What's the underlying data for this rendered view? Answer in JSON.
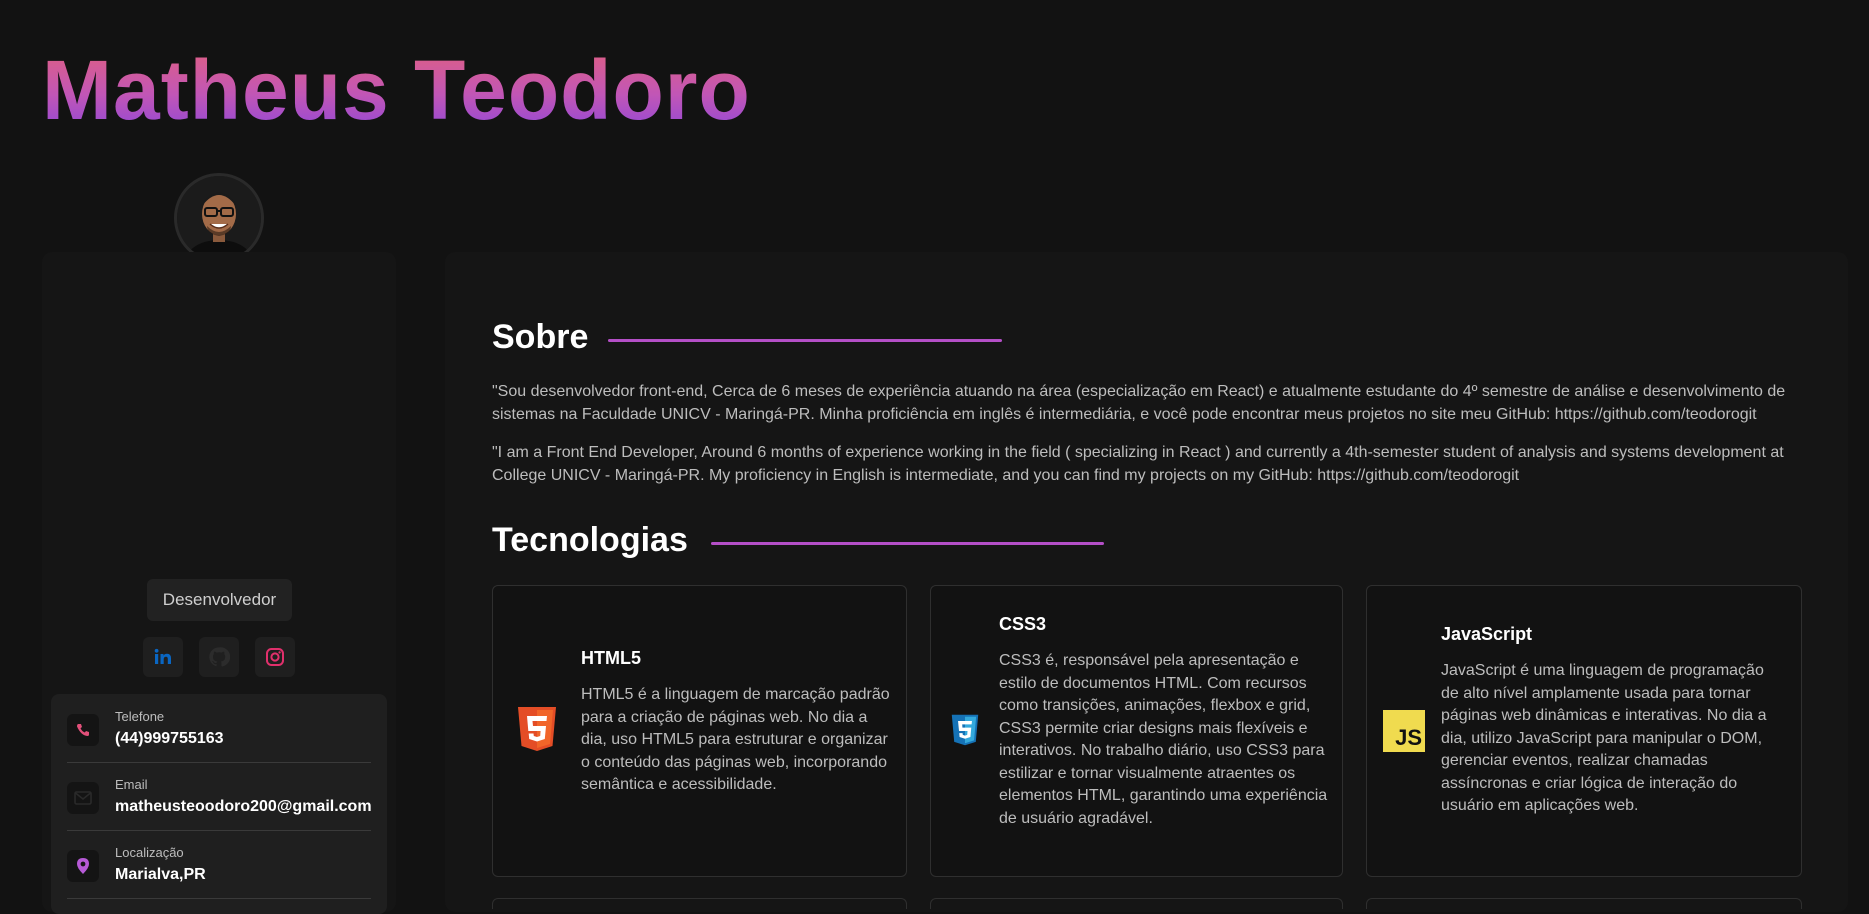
{
  "header": {
    "name": "Matheus Teodoro"
  },
  "profile": {
    "role": "Desenvolvedor",
    "social": [
      "linkedin-icon",
      "github-icon",
      "instagram-icon"
    ]
  },
  "contacts": [
    {
      "label": "Telefone",
      "value": "(44)999755163",
      "icon": "phone-icon"
    },
    {
      "label": "Email",
      "value": "matheusteoodoro200@gmail.com",
      "icon": "mail-icon"
    },
    {
      "label": "Localização",
      "value": "Marialva,PR",
      "icon": "location-pin-icon"
    }
  ],
  "about": {
    "title": "Sobre",
    "pt": "\"Sou desenvolvedor front-end, Cerca de 6 meses de experiência atuando na área (especialização em React) e atualmente estudante do 4º semestre de análise e desenvolvimento de sistemas na Faculdade UNICV - Maringá-PR. Minha proficiência em inglês é intermediária, e você pode encontrar meus projetos no site meu GitHub: https://github.com/teodorogit",
    "en": "\"I am a Front End Developer, Around 6 months of experience working in the field ( specializing in React ) and currently a 4th-semester student of analysis and systems development at College UNICV - Maringá-PR. My proficiency in English is intermediate, and you can find my projects on my GitHub: https://github.com/teodorogit"
  },
  "tech": {
    "title": "Tecnologias",
    "items": [
      {
        "name": "HTML5",
        "icon": "html5-icon",
        "desc": "HTML5 é a linguagem de marcação padrão para a criação de páginas web. No dia a dia, uso HTML5 para estruturar e organizar o conteúdo das páginas web, incorporando semântica e acessibilidade."
      },
      {
        "name": "CSS3",
        "icon": "css3-icon",
        "desc": "CSS3 é, responsável pela apresentação e estilo de documentos HTML. Com recursos como transições, animações, flexbox e grid, CSS3 permite criar designs mais flexíveis e interativos. No trabalho diário, uso CSS3 para estilizar e tornar visualmente atraentes os elementos HTML, garantindo uma experiência de usuário agradável."
      },
      {
        "name": "JavaScript",
        "icon": "javascript-icon",
        "icon_text": "JS",
        "desc": "JavaScript é uma linguagem de programação de alto nível amplamente usada para tornar páginas web dinâmicas e interativas. No dia a dia, utilizo JavaScript para manipular o DOM, gerenciar eventos, realizar chamadas assíncronas e criar lógica de interação do usuário em aplicações web."
      }
    ]
  },
  "colors": {
    "accent": "#b44fc7",
    "linkedin": "#0a66c2",
    "instagram": "#e1306c",
    "html5": "#e44d26",
    "css3": "#1572b6",
    "js": "#f0db4f"
  }
}
